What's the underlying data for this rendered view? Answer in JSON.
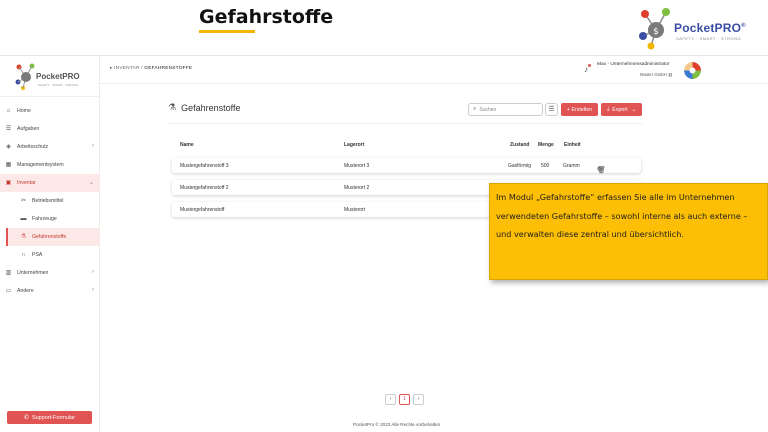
{
  "slide": {
    "title": "Gefahrstoffe",
    "accent_color": "#f2b705",
    "brand": {
      "name": "PocketPRO",
      "trademark": "®",
      "tagline": "SAFETY · SMART · STRONG"
    }
  },
  "sidebar": {
    "logo": {
      "name": "PocketPRO",
      "tagline": "SAFETY · SMART · STRONG"
    },
    "items": [
      {
        "label": "Home",
        "icon": "home-icon"
      },
      {
        "label": "Aufgaben",
        "icon": "list-icon"
      },
      {
        "label": "Arbeitsschutz",
        "icon": "shield-icon",
        "has_children": true
      },
      {
        "label": "Managementsystem",
        "icon": "grid-icon"
      },
      {
        "label": "Inventar",
        "icon": "box-icon",
        "expanded": true
      },
      {
        "label": "Betriebsmittel",
        "icon": "tools-icon"
      },
      {
        "label": "Fahrzeuge",
        "icon": "car-icon"
      },
      {
        "label": "Gefahrenstoffe",
        "icon": "flask-icon",
        "active": true
      },
      {
        "label": "PSA",
        "icon": "headset-icon"
      },
      {
        "label": "Unternehmen",
        "icon": "building-icon",
        "has_children": true
      },
      {
        "label": "Andere",
        "icon": "window-icon",
        "has_children": true
      }
    ],
    "support_button": "Support-Formular"
  },
  "topbar": {
    "breadcrumb": {
      "parent": "INVENTAR",
      "separator": "/",
      "current": "GEFAHRENSTOFFE"
    },
    "user": {
      "name": "Max - Unternehmensadministrator",
      "org": "Muster GmbH"
    }
  },
  "main": {
    "page_title": "Gefahrenstoffe",
    "search_placeholder": "Suchen",
    "create_label": "+ Erstellen",
    "export_label": "Export",
    "columns": [
      "Name",
      "Lagerort",
      "Zustand",
      "Menge",
      "Einheit"
    ],
    "rows": [
      {
        "name": "Mustergefahrenstoff 3",
        "lagerort": "Musterort 3",
        "zustand": "Gasförmig",
        "menge": "500",
        "einheit": "Gramm"
      },
      {
        "name": "Mustergefahrenstoff 2",
        "lagerort": "Musterort 2",
        "zustand": "",
        "menge": "",
        "einheit": ""
      },
      {
        "name": "Mustergefahrenstoff",
        "lagerort": "Musterort",
        "zustand": "",
        "menge": "",
        "einheit": ""
      }
    ],
    "pagination": {
      "prev": "‹",
      "current": "1",
      "next": "›"
    },
    "footer": "PocketPro © 2023 Alle Rechte vorbehalten"
  },
  "callout": {
    "text": "Im Modul „Gefahrstoffe“ erfassen Sie alle im Unternehmen verwendeten Gefahrstoffe – sowohl interne als auch externe – und verwalten diese zentral und übersichtlich.",
    "color": "#fcbf05"
  },
  "colors": {
    "primary": "#e05454",
    "active_bg": "#fde8e8"
  }
}
